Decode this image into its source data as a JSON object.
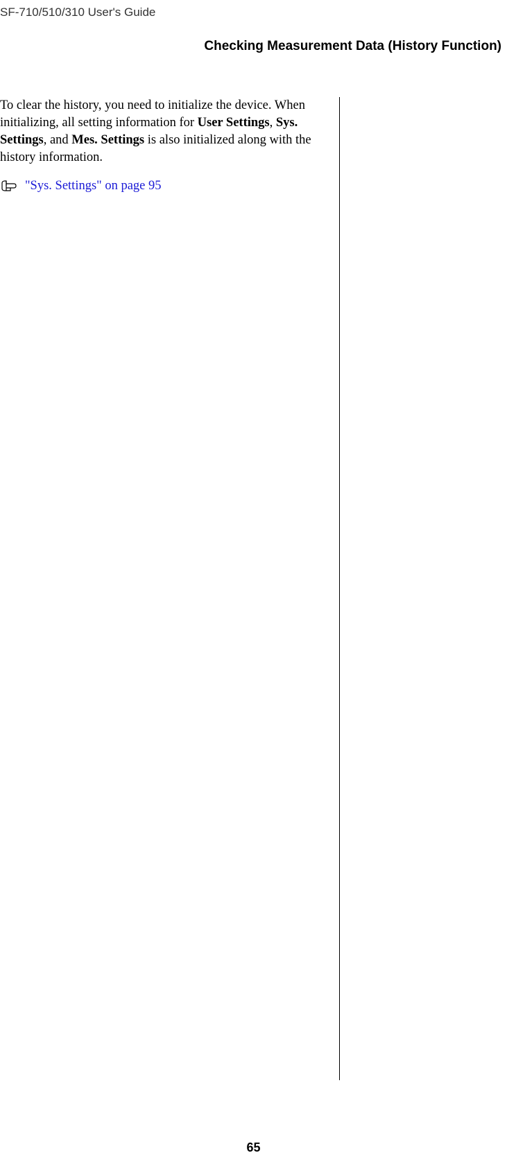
{
  "header": {
    "product": "SF-710/510/310     User's Guide"
  },
  "section": {
    "title": "Checking Measurement Data (History Function)"
  },
  "body": {
    "p1a": "To clear the history, you need to initialize the device. When initializing, all setting information for ",
    "p1b_bold": "User Settings",
    "p1c": ", ",
    "p1d_bold": "Sys. Settings",
    "p1e": ", and ",
    "p1f_bold": "Mes. Settings",
    "p1g": " is also initialized along with the history information."
  },
  "link": {
    "text": "\"Sys. Settings\" on page 95"
  },
  "footer": {
    "page_number": "65"
  }
}
